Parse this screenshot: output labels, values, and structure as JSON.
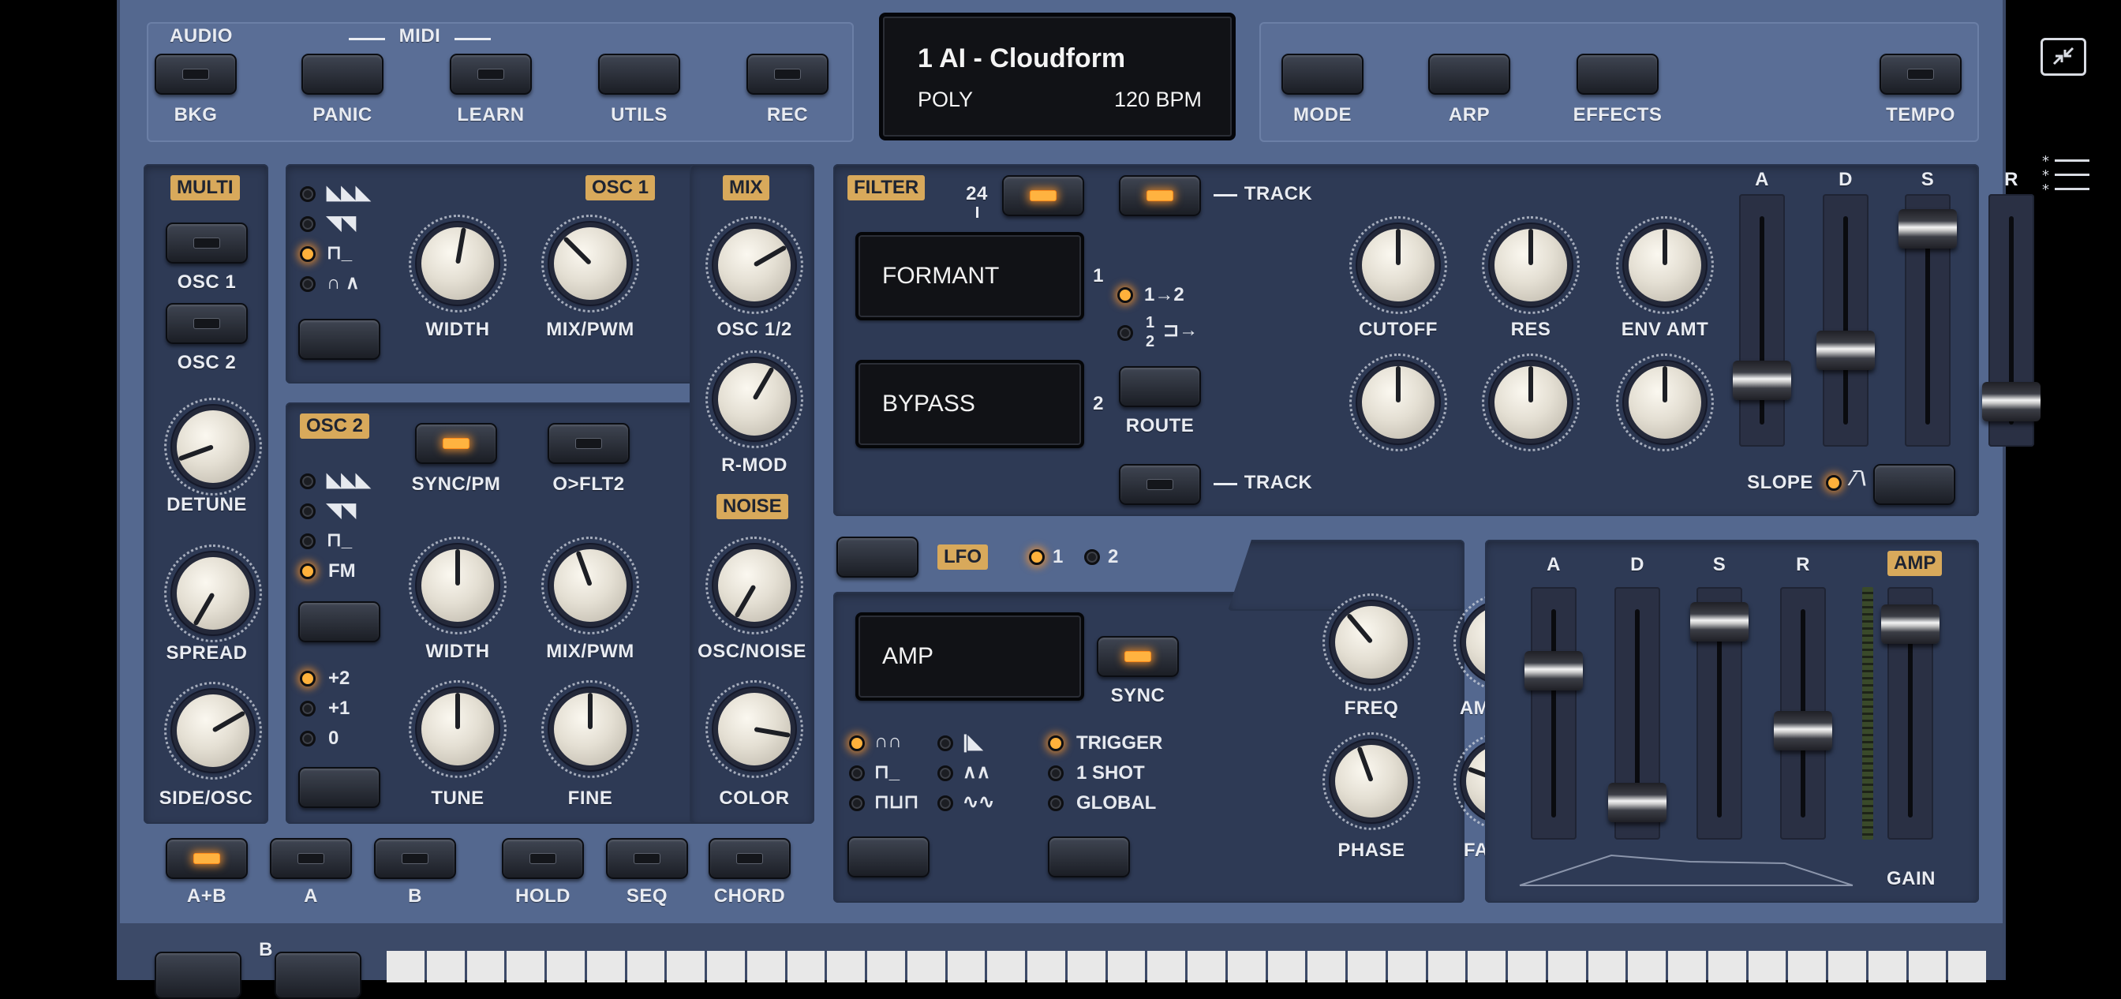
{
  "top": {
    "audio_label": "AUDIO",
    "midi_label": "MIDI",
    "bkg": "BKG",
    "panic": "PANIC",
    "learn": "LEARN",
    "utils": "UTILS",
    "rec": "REC",
    "mode": "MODE",
    "arp": "ARP",
    "effects": "EFFECTS",
    "tempo": "TEMPO"
  },
  "display": {
    "preset": "1 AI - Cloudform",
    "voice": "POLY",
    "bpm": "120 BPM"
  },
  "multi": {
    "tag": "MULTI",
    "osc1": "OSC 1",
    "osc2": "OSC 2",
    "detune": "DETUNE",
    "spread": "SPREAD",
    "side_osc": "SIDE/OSC"
  },
  "osc1": {
    "tag": "OSC 1",
    "width": "WIDTH",
    "mix_pwm": "MIX/PWM"
  },
  "osc2": {
    "tag": "OSC 2",
    "sync_pm": "SYNC/PM",
    "o_flt2": "O>FLT2",
    "fm": "FM",
    "width": "WIDTH",
    "mix_pwm": "MIX/PWM",
    "tune": "TUNE",
    "fine": "FINE",
    "oct_p2": "+2",
    "oct_p1": "+1",
    "oct_0": "0"
  },
  "mix": {
    "tag": "MIX",
    "osc12": "OSC 1/2",
    "rmod": "R-MOD",
    "noise_tag": "NOISE",
    "osc_noise": "OSC/NOISE",
    "color": "COLOR"
  },
  "filter": {
    "tag": "FILTER",
    "slope_24": "24",
    "track": "TRACK",
    "type1": "FORMANT",
    "type2": "BYPASS",
    "n1": "1",
    "n2": "2",
    "route_12": "1→2",
    "route_1": "1",
    "route_2": "2",
    "route": "ROUTE",
    "cutoff": "CUTOFF",
    "res": "RES",
    "env_amt": "ENV AMT",
    "track2": "TRACK"
  },
  "filter_env": {
    "a": "A",
    "d": "D",
    "s": "S",
    "r": "R",
    "slope": "SLOPE",
    "levels": {
      "a": 0.22,
      "d": 0.36,
      "s": 0.93,
      "r": 0.12
    }
  },
  "lfo": {
    "tag": "LFO",
    "n1": "1",
    "n2": "2",
    "dest": "AMP",
    "sync": "SYNC",
    "freq": "FREQ",
    "amount": "AMOUNT",
    "phase": "PHASE",
    "fade_in": "FADE IN",
    "trigger": "TRIGGER",
    "one_shot": "1 SHOT",
    "global": "GLOBAL"
  },
  "amp_env": {
    "a": "A",
    "d": "D",
    "s": "S",
    "r": "R",
    "tag": "AMP",
    "gain": "GAIN",
    "levels": {
      "a": 0.7,
      "d": 0.08,
      "s": 0.93,
      "r": 0.42,
      "gain": 0.92
    }
  },
  "voice": {
    "ab": "A+B",
    "a": "A",
    "b": "B",
    "hold": "HOLD",
    "seq": "SEQ",
    "chord": "CHORD"
  },
  "keyboard": {
    "label": "B"
  }
}
